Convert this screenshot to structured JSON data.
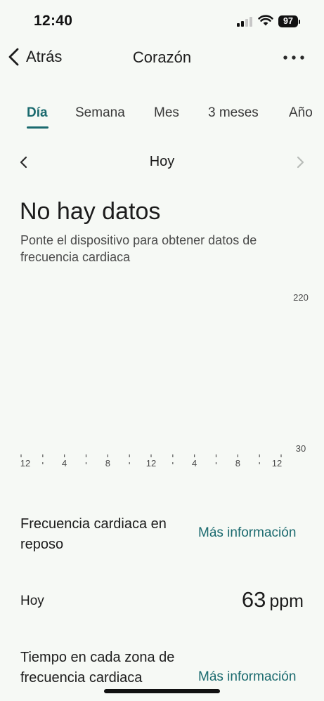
{
  "status_bar": {
    "time": "12:40",
    "battery": "97"
  },
  "nav": {
    "back_label": "Atrás",
    "title": "Corazón"
  },
  "tabs": [
    {
      "label": "Día",
      "active": true
    },
    {
      "label": "Semana"
    },
    {
      "label": "Mes"
    },
    {
      "label": "3 meses"
    },
    {
      "label": "Año"
    }
  ],
  "date_nav": {
    "label": "Hoy"
  },
  "empty_state": {
    "title": "No hay datos",
    "message": "Ponte el dispositivo para obtener datos de frecuencia cardiaca"
  },
  "chart_data": {
    "type": "line",
    "x_tick_labels": [
      "12",
      "4",
      "8",
      "12",
      "4",
      "8",
      "12"
    ],
    "y_tick_labels": [
      "220",
      "30"
    ],
    "ylim": [
      30,
      220
    ],
    "series": []
  },
  "resting_hr": {
    "title": "Frecuencia cardiaca en reposo",
    "link": "Más información"
  },
  "today_row": {
    "label": "Hoy",
    "value": "63",
    "unit": "ppm"
  },
  "zones": {
    "title": "Tiempo en cada zona de frecuencia cardiaca",
    "link": "Más información"
  }
}
